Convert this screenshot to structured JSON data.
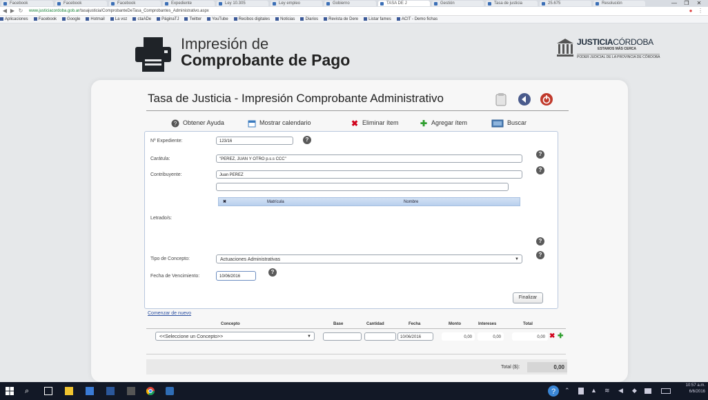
{
  "browser": {
    "tabs": [
      {
        "label": "Facebook"
      },
      {
        "label": "Facebook"
      },
      {
        "label": "Facebook"
      },
      {
        "label": "Expediente"
      },
      {
        "label": "Ley 10.305"
      },
      {
        "label": "Ley empleo"
      },
      {
        "label": "Gobierno"
      },
      {
        "label": "TASA DE J"
      },
      {
        "label": "Gestión"
      },
      {
        "label": "Tasa de justicia"
      },
      {
        "label": "25.675"
      },
      {
        "label": "Resolución"
      }
    ],
    "url_host": "www.justiciacordoba.gob.ar",
    "url_path": "/tasajusticia/ComprobanteDeTasa_Comprobantes_Administrativo.aspx",
    "bookmarks": [
      "Aplicaciones",
      "Facebook",
      "Google",
      "Hotmail",
      "La voz",
      "ctaADe",
      "PáginaTJ",
      "Twitter",
      "YouTube",
      "Recibos digitales",
      "Noticias",
      "Diarios",
      "Revista de Dere",
      "Listar fames",
      "ACIT - Demo fichas"
    ],
    "window_controls": [
      "—",
      "❐",
      "✕"
    ]
  },
  "header": {
    "title_line1": "Impresión de",
    "title_line2": "Comprobante de Pago",
    "logo_main": "JUSTICIA",
    "logo_sub": "CÓRDOBA",
    "logo_line2": "ESTAMOS MÁS CERCA",
    "logo_line3": "PODER JUDICIAL DE LA PROVINCIA DE CÓRDOBA"
  },
  "page": {
    "title": "Tasa de Justicia - Impresión Comprobante Administrativo"
  },
  "toolbar": {
    "help": "Obtener Ayuda",
    "calendar": "Mostrar calendario",
    "delete": "Eliminar ítem",
    "add": "Agregar ítem",
    "search": "Buscar"
  },
  "form": {
    "expediente_label": "Nº Expediente:",
    "expediente_value": "123/16",
    "caratula_label": "Carátula:",
    "caratula_value": "\"PEREZ, JUAN Y OTRO p.s.s CCC\"",
    "contribuyente_label": "Contribuyente:",
    "contribuyente_value": "Juan PEREZ",
    "letrados_label": "Letrado/s:",
    "grid_cols": [
      "Matrícula",
      "Nombre"
    ],
    "tipo_label": "Tipo de Concepto:",
    "tipo_value": "Actuaciones Administrativas",
    "fecha_label": "Fecha de Vencimiento:",
    "fecha_value": "10/06/2016",
    "finalizar": "Finalizar"
  },
  "items": {
    "comenzar": "Comenzar de nuevo",
    "headers": {
      "concepto": "Concepto",
      "base": "Base",
      "cantidad": "Cantidad",
      "fecha": "Fecha",
      "monto": "Monto",
      "intereses": "Intereses",
      "total": "Total"
    },
    "row": {
      "concepto": "<<Seleccione un Concepto>>",
      "base": "",
      "cantidad": "",
      "fecha": "10/06/2016",
      "monto": "0,00",
      "intereses": "0,00",
      "total": "0,00"
    },
    "total_label": "Total ($):",
    "total_value": "0,00"
  },
  "taskbar": {
    "time": "10:57 a.m.",
    "date": "6/6/2016"
  }
}
